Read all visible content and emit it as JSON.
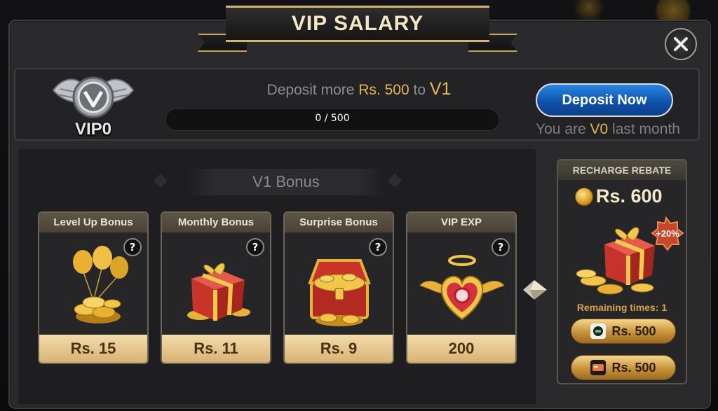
{
  "title": "VIP SALARY",
  "vip": {
    "level_label": "VIP0",
    "deposit_prefix": "Deposit more",
    "deposit_amount": "Rs. 500",
    "deposit_to": "to",
    "next_level": "V1",
    "progress_text": "0 / 500",
    "progress_fraction": 0,
    "deposit_button": "Deposit Now",
    "last_month_prefix": "You are",
    "last_month_level": "V0",
    "last_month_suffix": "last month"
  },
  "bonus_section": {
    "title": "V1 Bonus",
    "cards": [
      {
        "label": "Level Up Bonus",
        "value": "Rs. 15",
        "icon": "balloons-coins-icon"
      },
      {
        "label": "Monthly Bonus",
        "value": "Rs. 11",
        "icon": "gift-box-icon"
      },
      {
        "label": "Surprise Bonus",
        "value": "Rs. 9",
        "icon": "treasure-chest-icon"
      },
      {
        "label": "VIP EXP",
        "value": "200",
        "icon": "winged-heart-icon"
      }
    ],
    "help_glyph": "?"
  },
  "rebate": {
    "title": "RECHARGE REBATE",
    "amount": "Rs. 600",
    "badge": "+20%",
    "remaining": "Remaining times: 1",
    "buttons": [
      {
        "label": "Rs. 500",
        "icon": "payment-app-icon"
      },
      {
        "label": "Rs. 500",
        "icon": "payment-card-icon"
      }
    ]
  },
  "close_glyph": "✕",
  "colors": {
    "gold": "#e2b558",
    "blue_button": "#0e4fa8",
    "panel": "#2a2a2c"
  }
}
